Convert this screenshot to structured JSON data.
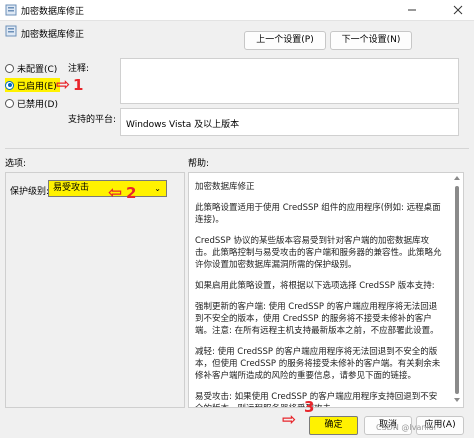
{
  "window": {
    "title": "加密数据库修正",
    "policy_title": "加密数据库修正"
  },
  "nav": {
    "prev_label": "上一个设置(P)",
    "next_label": "下一个设置(N)"
  },
  "state": {
    "options": [
      {
        "label": "未配置(C)",
        "checked": false
      },
      {
        "label": "已启用(E)",
        "checked": true
      },
      {
        "label": "已禁用(D)",
        "checked": false
      }
    ]
  },
  "fields": {
    "comment_label": "注释:",
    "comment_value": "",
    "platform_label": "支持的平台:",
    "platform_value": "Windows Vista 及以上版本"
  },
  "sections": {
    "options_label": "选项:",
    "help_label": "帮助:"
  },
  "protection": {
    "label": "保护级别:",
    "selected": "易受攻击"
  },
  "help": {
    "paragraphs": [
      "加密数据库修正",
      "此策略设置适用于使用 CredSSP 组件的应用程序(例如: 远程桌面连接)。",
      "CredSSP 协议的某些版本容易受到针对客户端的加密数据库攻击。此策略控制与易受攻击的客户端和服务器的兼容性。此策略允许你设置加密数据库漏洞所需的保护级别。",
      "如果启用此策略设置，将根据以下选项选择 CredSSP 版本支持:",
      "强制更新的客户端: 使用 CredSSP 的客户端应用程序将无法回退到不安全的版本，使用 CredSSP 的服务将不接受未修补的客户端。注意: 在所有远程主机支持最新版本之前，不应部署此设置。",
      "减轻: 使用 CredSSP 的客户端应用程序将无法回退到不安全的版本，但使用 CredSSP 的服务将接受未修补的客户端。有关剩余未修补客户端所造成的风险的重要信息，请参见下面的链接。",
      "易受攻击: 如果使用 CredSSP 的客户端应用程序支持回退到不安全的版本，则远程服务器将受到攻击。"
    ]
  },
  "footer": {
    "ok_label": "确定",
    "cancel_label": "取消",
    "apply_label": "应用(A)",
    "watermark": "CSDN @Ivaniui"
  },
  "annotations": {
    "marker_1": "1",
    "marker_2": "2",
    "marker_3": "3"
  },
  "colors": {
    "highlight": "#fff200",
    "annotation_red": "#e8262c",
    "accent": "#0067c0"
  }
}
